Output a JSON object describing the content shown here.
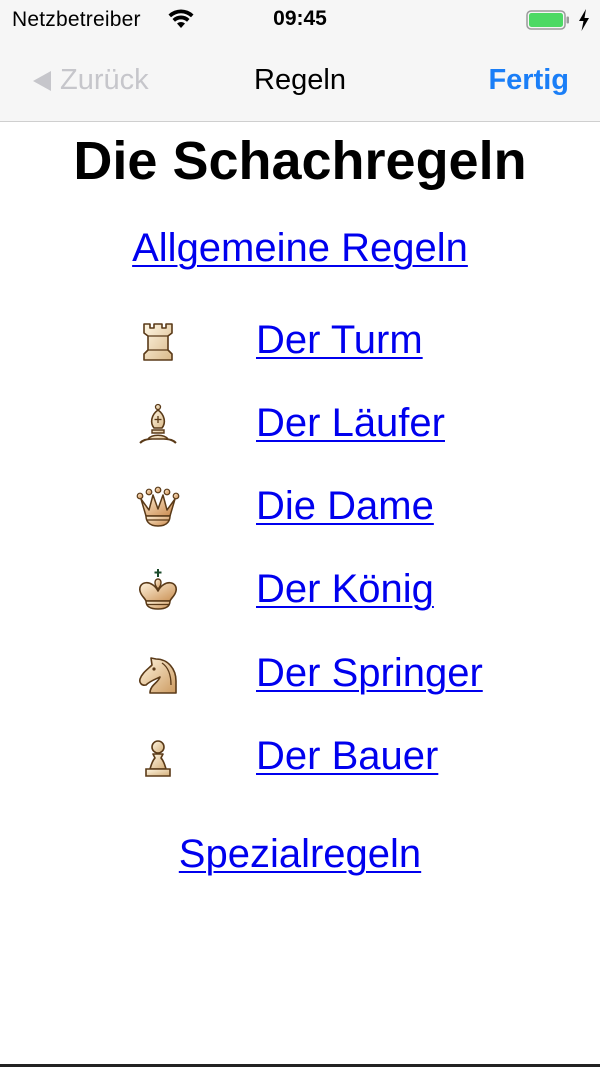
{
  "status_bar": {
    "carrier": "Netzbetreiber",
    "time": "09:45",
    "icons": [
      "wifi-icon",
      "battery-icon",
      "charging-bolt-icon"
    ],
    "battery_color": "#4cd964"
  },
  "nav_bar": {
    "back_label": "Zurück",
    "title": "Regeln",
    "done_label": "Fertig",
    "accent_color": "#1a7ef7"
  },
  "content": {
    "title": "Die Schachregeln",
    "general_rules_link": "Allgemeine Regeln",
    "pieces": [
      {
        "icon": "rook-icon",
        "label": "Der Turm"
      },
      {
        "icon": "bishop-icon",
        "label": "Der Läufer"
      },
      {
        "icon": "queen-icon",
        "label": "Die Dame"
      },
      {
        "icon": "king-icon",
        "label": "Der König"
      },
      {
        "icon": "knight-icon",
        "label": "Der Springer"
      },
      {
        "icon": "pawn-icon",
        "label": "Der Bauer"
      }
    ],
    "special_rules_link": "Spezialregeln",
    "link_color": "#0000ee"
  }
}
